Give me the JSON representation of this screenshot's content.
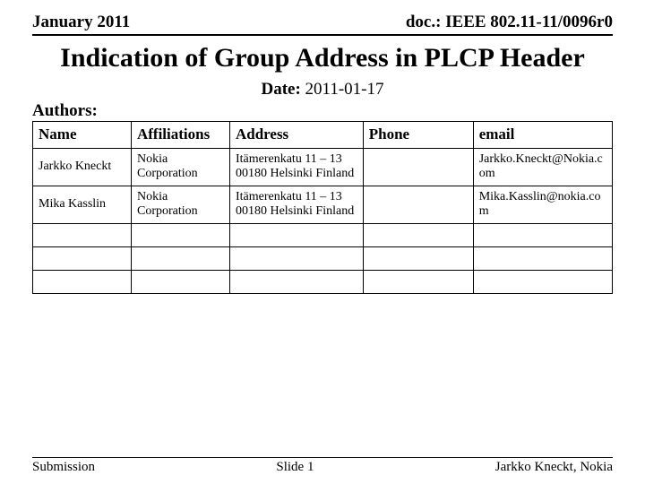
{
  "header": {
    "date_text": "January 2011",
    "doc_id": "doc.: IEEE 802.11-11/0096r0"
  },
  "title": "Indication of Group Address in PLCP Header",
  "dateline": {
    "label": "Date:",
    "value": "2011-01-17"
  },
  "authors_label": "Authors:",
  "table": {
    "headers": {
      "name": "Name",
      "affil": "Affiliations",
      "addr": "Address",
      "phone": "Phone",
      "email": "email"
    },
    "rows": [
      {
        "name": "Jarkko Kneckt",
        "affil": "Nokia Corporation",
        "addr": "Itämerenkatu 11 – 13 00180 Helsinki Finland",
        "phone": "",
        "email": "Jarkko.Kneckt@Nokia.com"
      },
      {
        "name": "Mika Kasslin",
        "affil": "Nokia Corporation",
        "addr": "Itämerenkatu 11 – 13 00180 Helsinki Finland",
        "phone": "",
        "email": "Mika.Kasslin@nokia.com"
      },
      {
        "name": "",
        "affil": "",
        "addr": "",
        "phone": "",
        "email": ""
      },
      {
        "name": "",
        "affil": "",
        "addr": "",
        "phone": "",
        "email": ""
      },
      {
        "name": "",
        "affil": "",
        "addr": "",
        "phone": "",
        "email": ""
      }
    ]
  },
  "footer": {
    "left": "Submission",
    "center": "Slide 1",
    "right": "Jarkko Kneckt, Nokia"
  }
}
